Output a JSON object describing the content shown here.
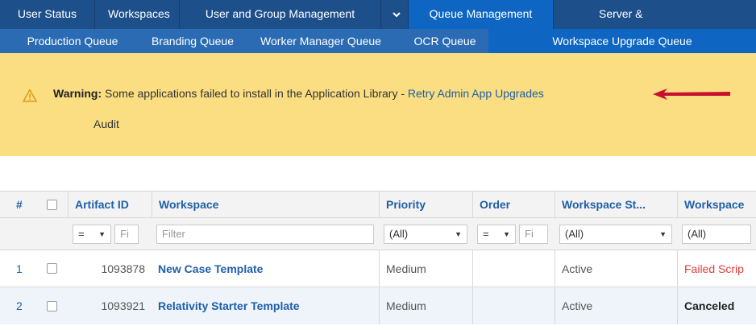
{
  "topnav": {
    "tabs": [
      "User Status",
      "Workspaces",
      "User and Group Management",
      "Queue Management",
      "Server &"
    ],
    "chevron": "chevron-down-icon"
  },
  "subnav": {
    "tabs": [
      "Production Queue",
      "Branding Queue",
      "Worker Manager Queue",
      "OCR Queue",
      "Workspace Upgrade Queue"
    ]
  },
  "warning": {
    "label": "Warning:",
    "message": " Some applications failed to install in the Application Library - ",
    "link": "Retry Admin App Upgrades",
    "audit": "Audit",
    "icon": "warning-icon",
    "accent": "#fbde82"
  },
  "grid": {
    "headers": {
      "num": "#",
      "artifact_id": "Artifact ID",
      "workspace": "Workspace",
      "priority": "Priority",
      "order": "Order",
      "workspace_status": "Workspace St...",
      "workspace_extra": "Workspace"
    },
    "filters": {
      "artifact_op": "=",
      "artifact_placeholder": "Fi",
      "workspace_placeholder": "Filter",
      "priority": "(All)",
      "order_op": "=",
      "order_placeholder": "Fi",
      "workspace_status": "(All)",
      "workspace_extra": "(All)"
    },
    "rows": [
      {
        "num": "1",
        "artifact_id": "1093878",
        "workspace": "New Case Template",
        "priority": "Medium",
        "order": "",
        "status": "Active",
        "upgrade_status": "Failed Scrip"
      },
      {
        "num": "2",
        "artifact_id": "1093921",
        "workspace": "Relativity Starter Template",
        "priority": "Medium",
        "order": "",
        "status": "Active",
        "upgrade_status": "Canceled"
      }
    ]
  }
}
